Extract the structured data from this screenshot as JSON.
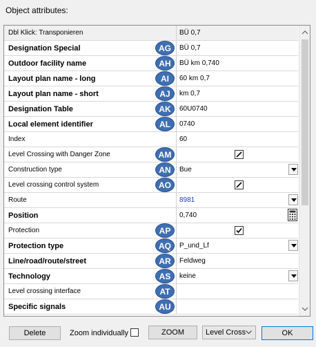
{
  "dialog": {
    "title": "Object attributes:"
  },
  "grid": {
    "header": {
      "label": "Dbl Klick: Transponieren",
      "value": "BÜ 0,7"
    },
    "rows": [
      {
        "label": "Designation Special",
        "bold": true,
        "badge": "AG",
        "value": "BÜ 0,7",
        "type": "text"
      },
      {
        "label": "Outdoor facility name",
        "bold": true,
        "badge": "AH",
        "value": "BÜ km 0,740",
        "type": "text"
      },
      {
        "label": "Layout plan name - long",
        "bold": true,
        "badge": "AI",
        "value": "60 km 0,7",
        "type": "text"
      },
      {
        "label": "Layout plan name - short",
        "bold": true,
        "badge": "AJ",
        "value": "km 0,7",
        "type": "text"
      },
      {
        "label": "Designation Table",
        "bold": true,
        "badge": "AK",
        "value": "60U0740",
        "type": "text"
      },
      {
        "label": "Local element identifier",
        "bold": true,
        "badge": "AL",
        "value": "0740",
        "type": "text"
      },
      {
        "label": "Index",
        "bold": false,
        "badge": "",
        "value": "60",
        "type": "text"
      },
      {
        "label": "Level Crossing with Danger Zone",
        "bold": false,
        "badge": "AM",
        "value": "",
        "type": "check-edit"
      },
      {
        "label": "Construction type",
        "bold": false,
        "badge": "AN",
        "value": "Bue",
        "type": "combo"
      },
      {
        "label": "Level crossing control system",
        "bold": false,
        "badge": "AO",
        "value": "",
        "type": "check-edit"
      },
      {
        "label": "Route",
        "bold": false,
        "badge": "",
        "value": "8981",
        "type": "combo-link"
      },
      {
        "label": "Position",
        "bold": true,
        "badge": "",
        "value": "0,740",
        "type": "calc"
      },
      {
        "label": "Protection",
        "bold": false,
        "badge": "AP",
        "value": "",
        "type": "check"
      },
      {
        "label": "Protection type",
        "bold": true,
        "badge": "AQ",
        "value": "P_und_Lf",
        "type": "combo"
      },
      {
        "label": "Line/road/route/street",
        "bold": true,
        "badge": "AR",
        "value": "Feldweg",
        "type": "text"
      },
      {
        "label": "Technology",
        "bold": true,
        "badge": "AS",
        "value": "keine",
        "type": "combo"
      },
      {
        "label": "Level crossing interface",
        "bold": false,
        "badge": "AT",
        "value": "",
        "type": "text"
      },
      {
        "label": "Specific signals",
        "bold": true,
        "badge": "AU",
        "value": "",
        "type": "text"
      }
    ]
  },
  "footer": {
    "delete_label": "Delete",
    "zoom_individually_label": "Zoom individually",
    "zoom_label": "ZOOM",
    "dropdown_value": "Level Cross",
    "ok_label": "OK"
  }
}
